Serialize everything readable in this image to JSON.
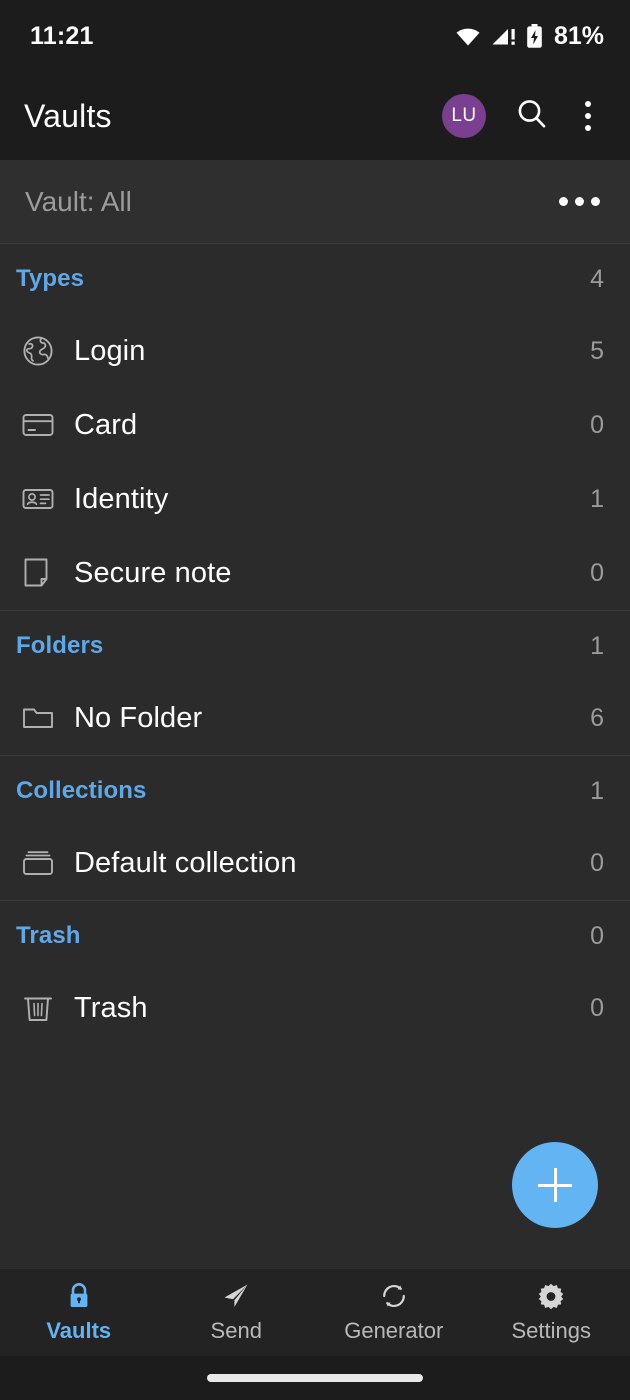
{
  "status_bar": {
    "time": "11:21",
    "battery_percent": "81%",
    "icons": [
      "wifi-icon",
      "cellular-signal-warning-icon",
      "battery-charging-icon"
    ]
  },
  "app_bar": {
    "title": "Vaults",
    "avatar_initials": "LU",
    "avatar_color": "#7a3f8e",
    "search_icon": "search-icon",
    "overflow_icon": "more-vertical-icon"
  },
  "vault_filter": {
    "label": "Vault: All",
    "overflow_icon": "more-horizontal-icon"
  },
  "sections": [
    {
      "title": "Types",
      "count": "4",
      "rows": [
        {
          "icon": "globe-icon",
          "label": "Login",
          "count": "5"
        },
        {
          "icon": "credit-card-icon",
          "label": "Card",
          "count": "0"
        },
        {
          "icon": "id-card-icon",
          "label": "Identity",
          "count": "1"
        },
        {
          "icon": "note-icon",
          "label": "Secure note",
          "count": "0"
        }
      ]
    },
    {
      "title": "Folders",
      "count": "1",
      "rows": [
        {
          "icon": "folder-icon",
          "label": "No Folder",
          "count": "6"
        }
      ]
    },
    {
      "title": "Collections",
      "count": "1",
      "rows": [
        {
          "icon": "collection-stack-icon",
          "label": "Default collection",
          "count": "0"
        }
      ]
    },
    {
      "title": "Trash",
      "count": "0",
      "rows": [
        {
          "icon": "trash-icon",
          "label": "Trash",
          "count": "0"
        }
      ]
    }
  ],
  "fab": {
    "icon": "plus-icon",
    "color": "#63b4f3"
  },
  "bottom_nav": {
    "active_color": "#63b4f3",
    "items": [
      {
        "icon": "lock-icon",
        "label": "Vaults",
        "active": true
      },
      {
        "icon": "send-paper-plane-icon",
        "label": "Send",
        "active": false
      },
      {
        "icon": "refresh-generator-icon",
        "label": "Generator",
        "active": false
      },
      {
        "icon": "gear-icon",
        "label": "Settings",
        "active": false
      }
    ]
  }
}
